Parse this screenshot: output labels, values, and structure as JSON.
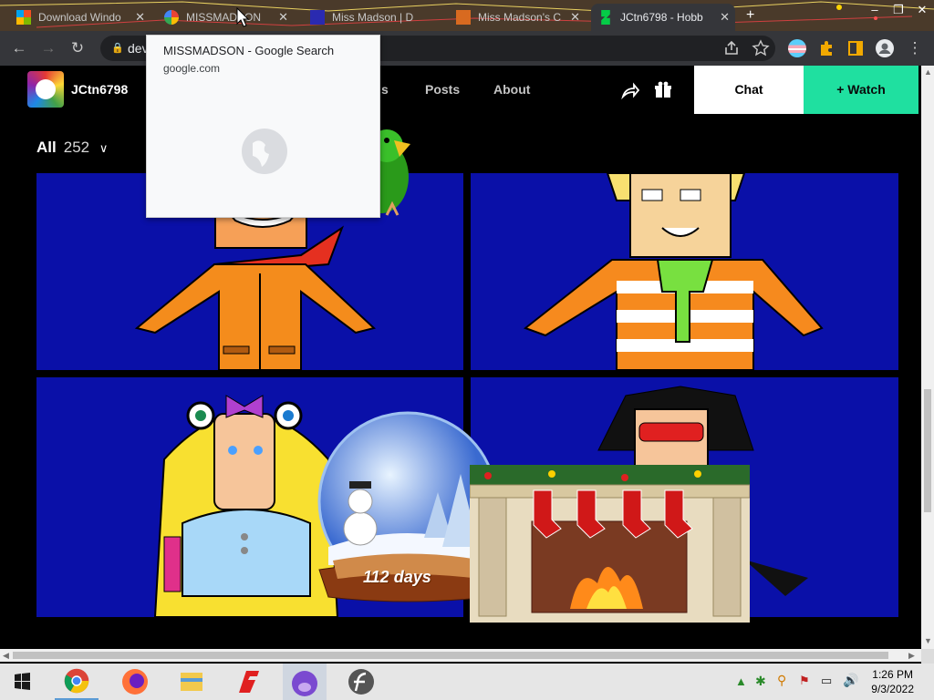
{
  "browser": {
    "tabs": [
      {
        "title": "Download Windo",
        "favicon": "windows-logo-icon",
        "active": false
      },
      {
        "title": "MISSMADSON",
        "favicon": "google-icon",
        "active": false
      },
      {
        "title": "Miss Madson | D",
        "favicon": "site-icon",
        "active": false
      },
      {
        "title": "Miss Madson's C",
        "favicon": "site-icon",
        "active": false
      },
      {
        "title": "JCtn6798 - Hobb",
        "favicon": "deviantart-icon",
        "active": true
      }
    ],
    "new_tab_label": "+",
    "window_controls": {
      "minimize": "–",
      "restore": "❐",
      "close": "✕"
    },
    "address": "dev",
    "tab_hover": {
      "title": "MISSMADSON - Google Search",
      "url": "google.com"
    }
  },
  "site": {
    "username": "JCtn6798",
    "nav": [
      "s",
      "Posts",
      "About"
    ],
    "chat_label": "Chat",
    "watch_label": "+ Watch",
    "accent": "#1fe0a0"
  },
  "gallery": {
    "filter_label": "All",
    "count": "252",
    "overlay_text": "112 days",
    "background": "#0a10a8"
  },
  "taskbar": {
    "apps": [
      "chrome-icon",
      "firefox-icon",
      "file-explorer-icon",
      "s-app-icon",
      "bonzi-icon",
      "flash-icon"
    ],
    "time": "1:26 PM",
    "date": "9/3/2022"
  }
}
